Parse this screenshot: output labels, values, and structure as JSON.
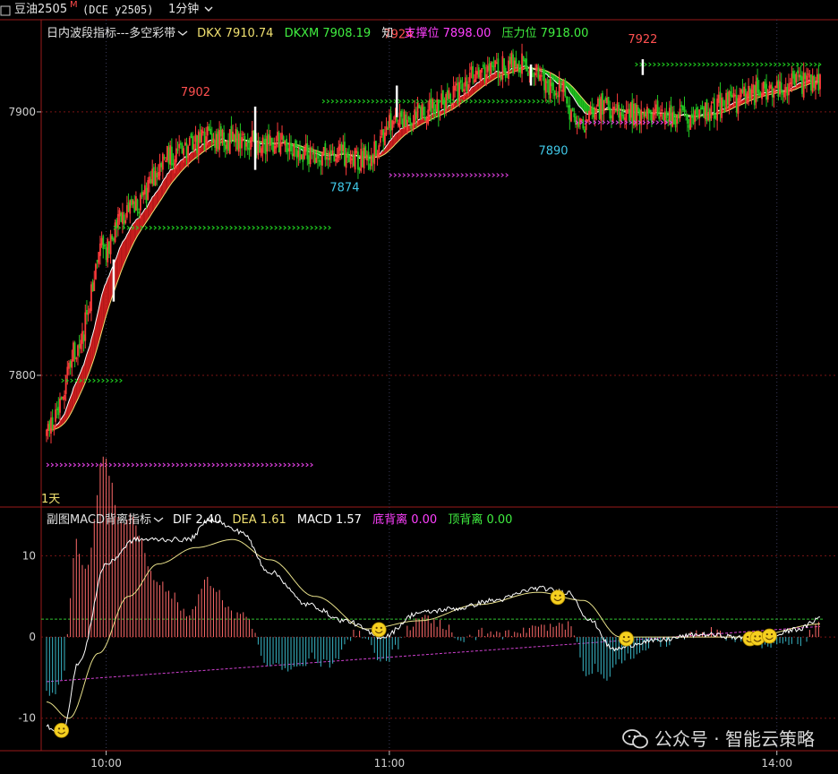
{
  "header": {
    "symbol": "豆油2505",
    "symbol_mark": "M",
    "exchange_code": "(DCE y2505)",
    "period": "1分钟"
  },
  "main_panel": {
    "indicator_name": "日内波段指标---多空彩带",
    "dkx_label": "DKX",
    "dkx_value": "7910.74",
    "dkxm_label": "DKXM",
    "dkxm_value": "7908.19",
    "zhi": "知",
    "support_label": "支撑位",
    "support_value": "7898.00",
    "resistance_label": "压力位",
    "resistance_value": "7918.00",
    "corner_label": "1天"
  },
  "sub_panel": {
    "indicator_name": "副图MACD背离指标",
    "dif_label": "DIF",
    "dif_value": "2.40",
    "dea_label": "DEA",
    "dea_value": "1.61",
    "macd_label": "MACD",
    "macd_value": "1.57",
    "bottom_div_label": "底背离",
    "bottom_div_value": "0.00",
    "top_div_label": "顶背离",
    "top_div_value": "0.00"
  },
  "watermark": "公众号 · 智能云策略",
  "colors": {
    "up": "#ff3b3b",
    "down": "#22c522",
    "ribbon_red": "#e02020",
    "ribbon_green": "#20d020",
    "support": "#e040e0",
    "resistance": "#20d020",
    "grid_red": "#7a1414",
    "axis": "#9a1a1a",
    "macd_up": "#ff6a6a",
    "macd_down": "#39b8c8",
    "dif": "#ffffff",
    "dea": "#e8e08a"
  },
  "chart_data": [
    {
      "type": "candlestick",
      "name": "price",
      "y_ticks": [
        7800,
        7900
      ],
      "ylim": [
        7750,
        7935
      ],
      "x_ticks": [
        "10:00",
        "11:00",
        "14:00"
      ],
      "annotations": [
        {
          "label": "7902",
          "kind": "high"
        },
        {
          "label": "7874",
          "kind": "low"
        },
        {
          "label": "7924",
          "kind": "high"
        },
        {
          "label": "7890",
          "kind": "low"
        },
        {
          "label": "7922",
          "kind": "high"
        }
      ],
      "support_levels": [
        7766,
        7876,
        7896
      ],
      "resistance_levels": [
        7798,
        7856,
        7904,
        7918
      ],
      "close_anchors": [
        [
          0,
          7778
        ],
        [
          8,
          7788
        ],
        [
          20,
          7810
        ],
        [
          38,
          7848
        ],
        [
          55,
          7862
        ],
        [
          85,
          7884
        ],
        [
          110,
          7890
        ],
        [
          150,
          7888
        ],
        [
          185,
          7884
        ],
        [
          215,
          7882
        ],
        [
          232,
          7896
        ],
        [
          260,
          7902
        ],
        [
          290,
          7914
        ],
        [
          315,
          7918
        ],
        [
          342,
          7910
        ],
        [
          358,
          7896
        ],
        [
          372,
          7902
        ],
        [
          395,
          7899
        ],
        [
          430,
          7898
        ],
        [
          460,
          7904
        ],
        [
          490,
          7910
        ],
        [
          520,
          7912
        ]
      ],
      "bar_count": 520
    },
    {
      "type": "macd",
      "name": "MACD",
      "y_ticks": [
        10,
        0,
        -10
      ],
      "ylim": [
        -14,
        16
      ],
      "dif_anchors": [
        [
          0,
          -11
        ],
        [
          10,
          -12
        ],
        [
          22,
          -3
        ],
        [
          40,
          9
        ],
        [
          60,
          12
        ],
        [
          95,
          12
        ],
        [
          110,
          14.5
        ],
        [
          130,
          13
        ],
        [
          150,
          8
        ],
        [
          175,
          4
        ],
        [
          200,
          2
        ],
        [
          225,
          0
        ],
        [
          250,
          3
        ],
        [
          275,
          3.5
        ],
        [
          300,
          4.5
        ],
        [
          330,
          6
        ],
        [
          350,
          5.5
        ],
        [
          365,
          2
        ],
        [
          380,
          -1.5
        ],
        [
          405,
          -0.5
        ],
        [
          440,
          0.3
        ],
        [
          480,
          -0.3
        ],
        [
          505,
          1
        ],
        [
          520,
          2.4
        ]
      ],
      "dea_anchors": [
        [
          0,
          -8
        ],
        [
          15,
          -10
        ],
        [
          35,
          -2
        ],
        [
          55,
          5
        ],
        [
          75,
          9
        ],
        [
          100,
          11
        ],
        [
          125,
          12
        ],
        [
          150,
          9.5
        ],
        [
          180,
          5
        ],
        [
          215,
          1
        ],
        [
          250,
          2
        ],
        [
          290,
          4
        ],
        [
          330,
          5.5
        ],
        [
          360,
          4.5
        ],
        [
          385,
          0
        ],
        [
          420,
          0
        ],
        [
          470,
          0
        ],
        [
          520,
          1.61
        ]
      ],
      "dashed_green_level": 2.2,
      "markers": [
        0.02,
        0.43,
        0.66,
        0.75,
        0.91,
        0.92,
        0.935
      ]
    }
  ]
}
